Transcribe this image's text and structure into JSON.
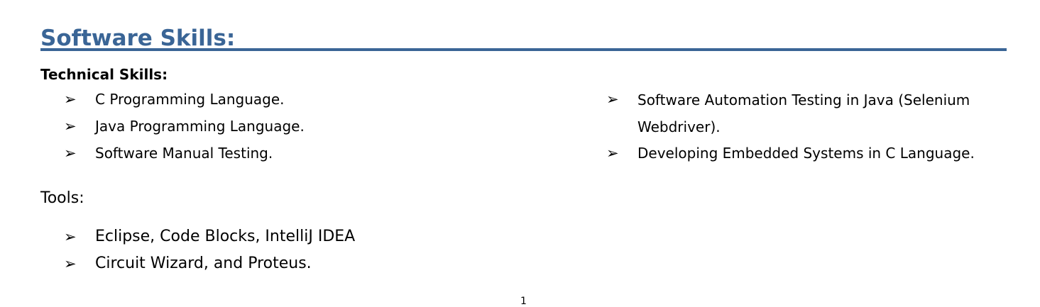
{
  "section": {
    "title": "Software Skills:",
    "technical_skills": {
      "label": "Technical Skills:",
      "left_items": [
        "C Programming Language.",
        "Java Programming Language.",
        "Software Manual Testing."
      ],
      "right_items": [
        "Software Automation Testing in Java (Selenium Webdriver).",
        "Developing Embedded Systems in C Language."
      ]
    },
    "tools": {
      "label": "Tools:",
      "items": [
        "Eclipse, Code Blocks, IntelliJ IDEA",
        "Circuit Wizard, and Proteus."
      ]
    }
  },
  "bullet_glyph": "➢",
  "page_number": "1",
  "colors": {
    "heading": "#3a6596",
    "text": "#000000"
  }
}
